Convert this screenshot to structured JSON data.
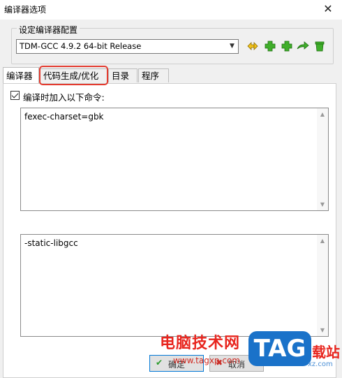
{
  "window": {
    "title": "编译器选项",
    "close_glyph": "✕"
  },
  "config": {
    "group_label": "设定编译器配置",
    "selected": "TDM-GCC 4.9.2 64-bit Release",
    "toolbar_icons": [
      "rename-config-icon",
      "add-config-icon",
      "add-blank-config-icon",
      "redirect-config-icon",
      "delete-config-icon"
    ]
  },
  "tabs": [
    {
      "label": "编译器",
      "active": true
    },
    {
      "label": "代码生成/优化",
      "active": false,
      "highlighted": true
    },
    {
      "label": "目录",
      "active": false
    },
    {
      "label": "程序",
      "active": false
    }
  ],
  "compiler": {
    "add_commands_label": "编译时加入以下命令:",
    "add_commands_checked": true,
    "compiler_commands": "fexec-charset=gbk",
    "linker_commands": "-static-libgcc"
  },
  "buttons": {
    "ok_label": "确定",
    "cancel_label": "取消"
  },
  "watermark": {
    "site_name": "电脑技术网",
    "url": "www.tagxp.com",
    "logo": "TAG",
    "suffix": "载站",
    "suffix_small": "xz.com"
  },
  "colors": {
    "highlight": "#e33b2f",
    "accent": "#0078d7",
    "watermark_red": "#e8251e",
    "watermark_blue": "#1a72c9"
  }
}
